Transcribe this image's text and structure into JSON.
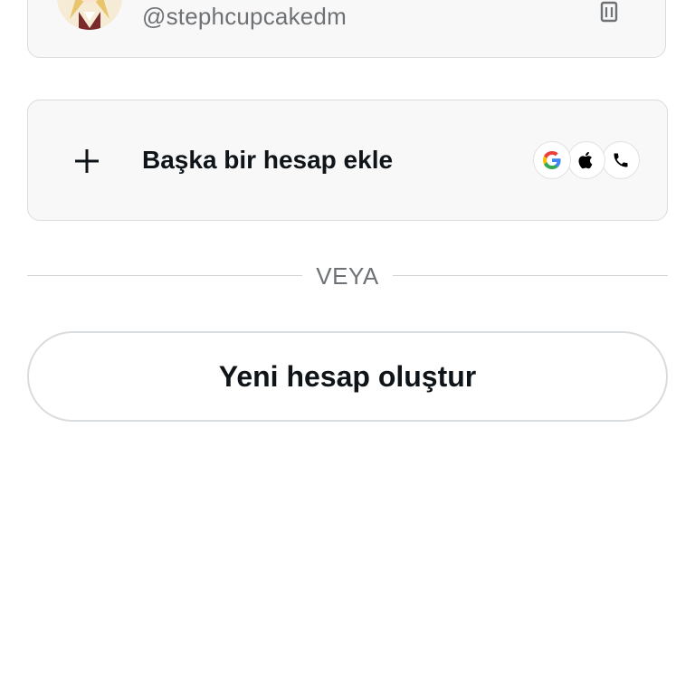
{
  "account": {
    "handle": "@stephcupcakedm"
  },
  "add_account": {
    "label": "Başka bir hesap ekle",
    "providers": [
      "google-icon",
      "apple-icon",
      "phone-icon"
    ]
  },
  "divider": {
    "text": "VEYA"
  },
  "create_account": {
    "label": "Yeni hesap oluştur"
  },
  "colors": {
    "text_primary": "#0f1419",
    "text_secondary": "#6f7275",
    "card_bg": "#f8f8f8",
    "border": "#dcdcdc"
  }
}
